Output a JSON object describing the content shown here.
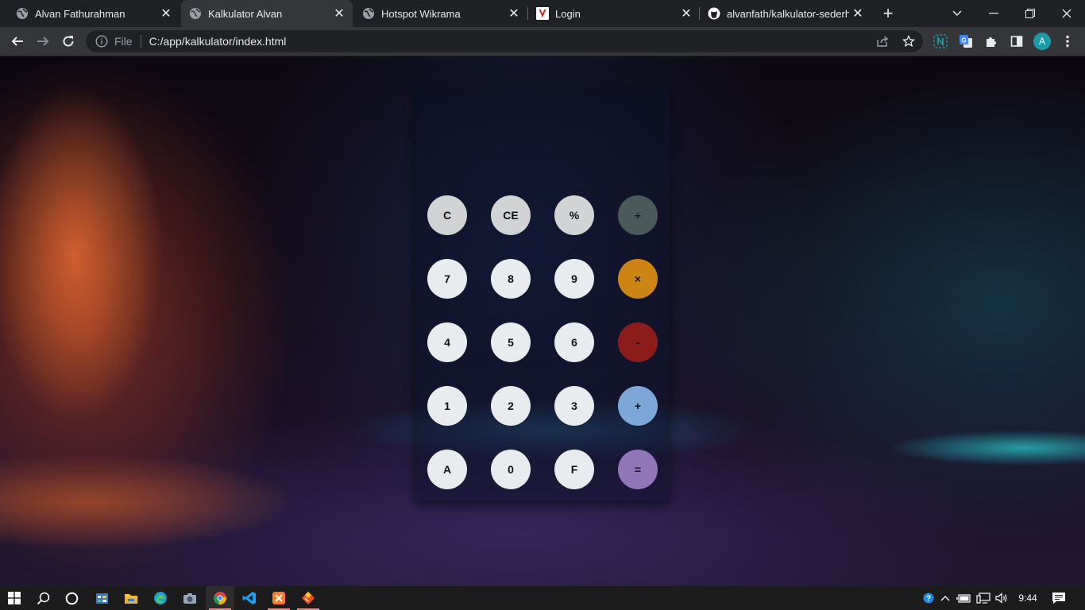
{
  "browser": {
    "tabs": [
      {
        "title": "Alvan Fathurahman",
        "active": false,
        "favicon": "globe-icon"
      },
      {
        "title": "Kalkulator Alvan",
        "active": true,
        "favicon": "globe-icon"
      },
      {
        "title": "Hotspot Wikrama",
        "active": false,
        "favicon": "globe-icon"
      },
      {
        "title": "Login",
        "active": false,
        "favicon": "v-logo-icon"
      },
      {
        "title": "alvanfath/kalkulator-sederhana",
        "active": false,
        "favicon": "github-icon"
      }
    ],
    "address": {
      "scheme": "File",
      "url": "C:/app/kalkulator/index.html"
    },
    "profile_initial": "A",
    "accent_color": "#1a9ba8"
  },
  "calculator": {
    "display": "",
    "keys": [
      {
        "label": "C",
        "color": "#d2d3d4"
      },
      {
        "label": "CE",
        "color": "#d2d3d4"
      },
      {
        "label": "%",
        "color": "#d2d3d4"
      },
      {
        "label": "÷",
        "color": "#4a5959"
      },
      {
        "label": "7",
        "color": "#e9ecef"
      },
      {
        "label": "8",
        "color": "#e9ecef"
      },
      {
        "label": "9",
        "color": "#e9ecef"
      },
      {
        "label": "×",
        "color": "#cc8412"
      },
      {
        "label": "4",
        "color": "#e9ecef"
      },
      {
        "label": "5",
        "color": "#e9ecef"
      },
      {
        "label": "6",
        "color": "#e9ecef"
      },
      {
        "label": "-",
        "color": "#8c1c1c"
      },
      {
        "label": "1",
        "color": "#e9ecef"
      },
      {
        "label": "2",
        "color": "#e9ecef"
      },
      {
        "label": "3",
        "color": "#e9ecef"
      },
      {
        "label": "+",
        "color": "#7ea6d6"
      },
      {
        "label": "A",
        "color": "#e9ecef"
      },
      {
        "label": "0",
        "color": "#e9ecef"
      },
      {
        "label": "F",
        "color": "#e9ecef"
      },
      {
        "label": "=",
        "color": "#9176b8"
      }
    ]
  },
  "taskbar": {
    "clock": "9:44",
    "pinned": [
      "windows-start-icon",
      "search-icon",
      "cortana-icon",
      "task-view-icon",
      "file-explorer-icon",
      "edge-icon",
      "camera-icon",
      "chrome-icon",
      "vscode-icon",
      "xampp-icon",
      "git-icon"
    ]
  }
}
